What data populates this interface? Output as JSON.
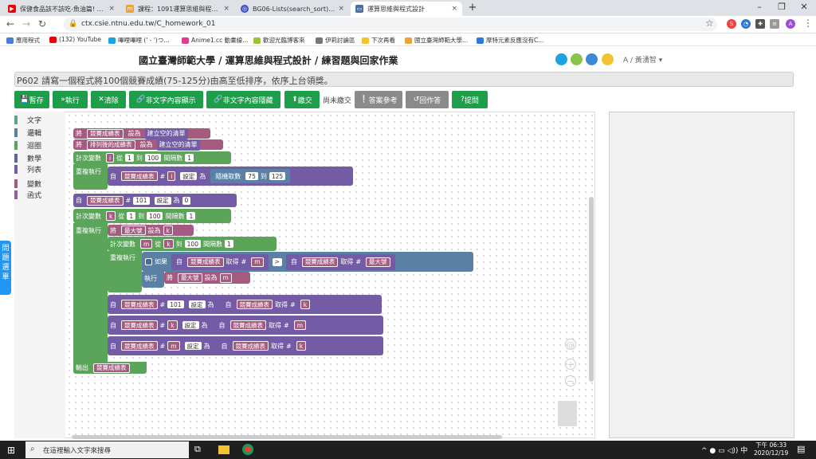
{
  "tabs": [
    {
      "title": "保健食品該不該吃-魚油篇! 第一支"
    },
    {
      "title": "課程：1091運算思維與程式設計"
    },
    {
      "title": "BG06-Lists(search_sort)(studen"
    },
    {
      "title": "運算思維與程式設計"
    }
  ],
  "address": "ctx.csie.ntnu.edu.tw/C_homework_01",
  "bookmarks": [
    "應用程式",
    "(132) YouTube",
    "嗶哩嗶哩 (' - ')つ...",
    "Anime1.cc 動畫線...",
    "歡迎光臨博客來",
    "伊莉討論區",
    "下次再看",
    "國立臺灣師範大學...",
    "摩特元素反應沒有C..."
  ],
  "site_title": "國立臺灣師範大學 / 運算思維與程式設計 / 練習題與回家作業",
  "user": "A / 黃湧智",
  "question": "P602 請寫一個程式將100個競賽成績(75-125分)由高至低排序，依序上台領獎。",
  "buttons": {
    "save": "暫存",
    "run": "執行",
    "clear": "清除",
    "show": "非文字內容顯示",
    "hide": "非文字內容隱藏",
    "submit": "繳交",
    "status": "尚未繳交",
    "answer": "答案參考",
    "restore": "回作答",
    "help": "提問"
  },
  "categories": [
    "文字",
    "邏輯",
    "迴圈",
    "數學",
    "列表",
    "變數",
    "函式"
  ],
  "side_tab": "問題選單",
  "blocks": {
    "set": "將",
    "to": "設為",
    "create_list": "建立空的清單",
    "list1": "競賽成績表",
    "list2": "排列後的成績表",
    "count": "計次變數",
    "from": "從",
    "to2": "到",
    "step": "間隔數",
    "do": "重複執行",
    "in": "自",
    "hash": "#",
    "set_at": "設定",
    "as": "為",
    "rand": "隨機取數",
    "i": "i",
    "k": "k",
    "m": "m",
    "max": "最大號",
    "n1": "1",
    "n100": "100",
    "n75": "75",
    "n125": "125",
    "n101": "101",
    "n0": "0",
    "if": "如果",
    "get": "取得",
    "gt": ">",
    "then": "執行",
    "output": "輸出"
  },
  "taskbar": {
    "search": "在這裡輸入文字來搜尋",
    "time": "下午 06:33",
    "date": "2020/12/19"
  }
}
